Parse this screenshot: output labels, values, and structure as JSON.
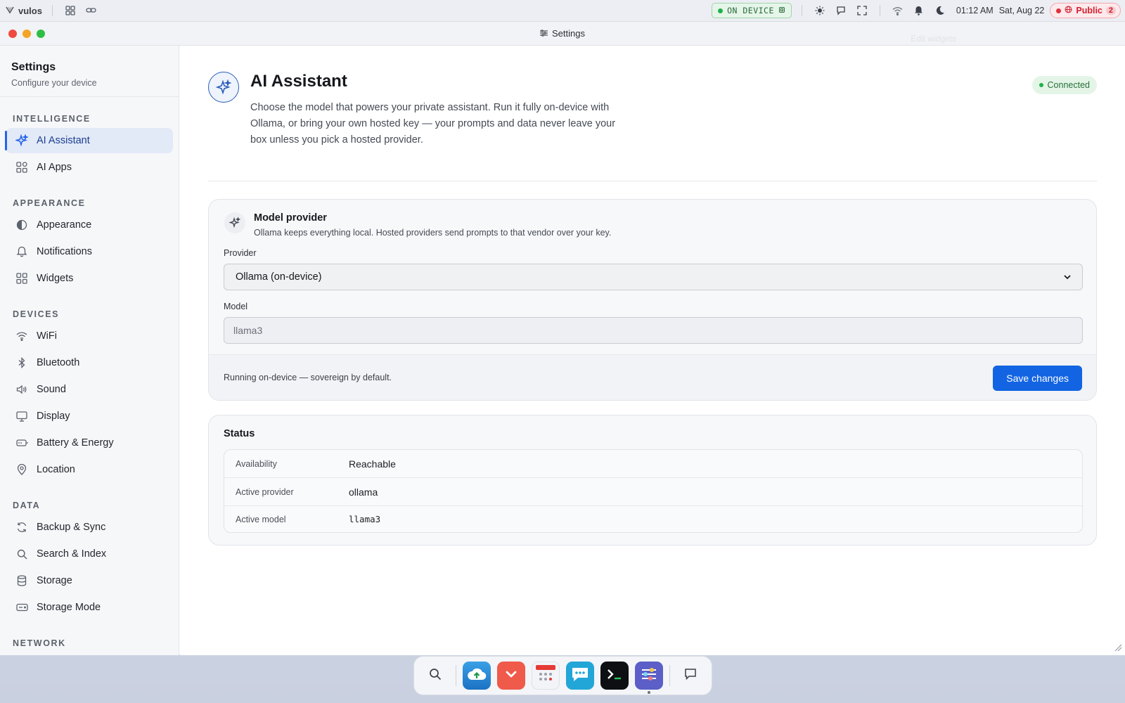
{
  "menubar": {
    "app_name": "vulos",
    "on_device_label": "ON DEVICE",
    "time": "01:12 AM",
    "date": "Sat, Aug 22",
    "public_label": "Public",
    "public_count": "2"
  },
  "window": {
    "title": "Settings",
    "edit_widgets": "Edit widgets"
  },
  "sidebar": {
    "title": "Settings",
    "subtitle": "Configure your device",
    "sections": [
      {
        "label": "INTELLIGENCE",
        "items": [
          {
            "label": "AI Assistant",
            "icon": "sparkle-icon",
            "active": true
          },
          {
            "label": "AI Apps",
            "icon": "apps-grid-icon"
          }
        ]
      },
      {
        "label": "APPEARANCE",
        "items": [
          {
            "label": "Appearance",
            "icon": "contrast-icon"
          },
          {
            "label": "Notifications",
            "icon": "bell-icon"
          },
          {
            "label": "Widgets",
            "icon": "widgets-icon"
          }
        ]
      },
      {
        "label": "DEVICES",
        "items": [
          {
            "label": "WiFi",
            "icon": "wifi-icon"
          },
          {
            "label": "Bluetooth",
            "icon": "bluetooth-icon"
          },
          {
            "label": "Sound",
            "icon": "speaker-icon"
          },
          {
            "label": "Display",
            "icon": "monitor-icon"
          },
          {
            "label": "Battery & Energy",
            "icon": "battery-icon"
          },
          {
            "label": "Location",
            "icon": "location-pin-icon"
          }
        ]
      },
      {
        "label": "DATA",
        "items": [
          {
            "label": "Backup & Sync",
            "icon": "sync-icon"
          },
          {
            "label": "Search & Index",
            "icon": "search-icon"
          },
          {
            "label": "Storage",
            "icon": "database-icon"
          },
          {
            "label": "Storage Mode",
            "icon": "drive-icon"
          }
        ]
      },
      {
        "label": "NETWORK",
        "items": []
      }
    ]
  },
  "main": {
    "title": "AI Assistant",
    "description": "Choose the model that powers your private assistant. Run it fully on-device with Ollama, or bring your own hosted key — your prompts and data never leave your box unless you pick a hosted provider.",
    "status_badge": "Connected",
    "provider_card": {
      "title": "Model provider",
      "description": "Ollama keeps everything local. Hosted providers send prompts to that vendor over your key.",
      "provider_label": "Provider",
      "provider_value": "Ollama (on-device)",
      "model_label": "Model",
      "model_value": "llama3",
      "footer_note": "Running on-device — sovereign by default.",
      "save_label": "Save changes"
    },
    "status_card": {
      "title": "Status",
      "rows": [
        {
          "key": "Availability",
          "value": "Reachable"
        },
        {
          "key": "Active provider",
          "value": "ollama"
        },
        {
          "key": "Active model",
          "value": "llama3"
        }
      ]
    }
  },
  "colors": {
    "accent": "#1264e3",
    "connected_bg": "#e4f5e7",
    "public_red": "#d0202f",
    "on_device_green": "#1fb24a"
  }
}
